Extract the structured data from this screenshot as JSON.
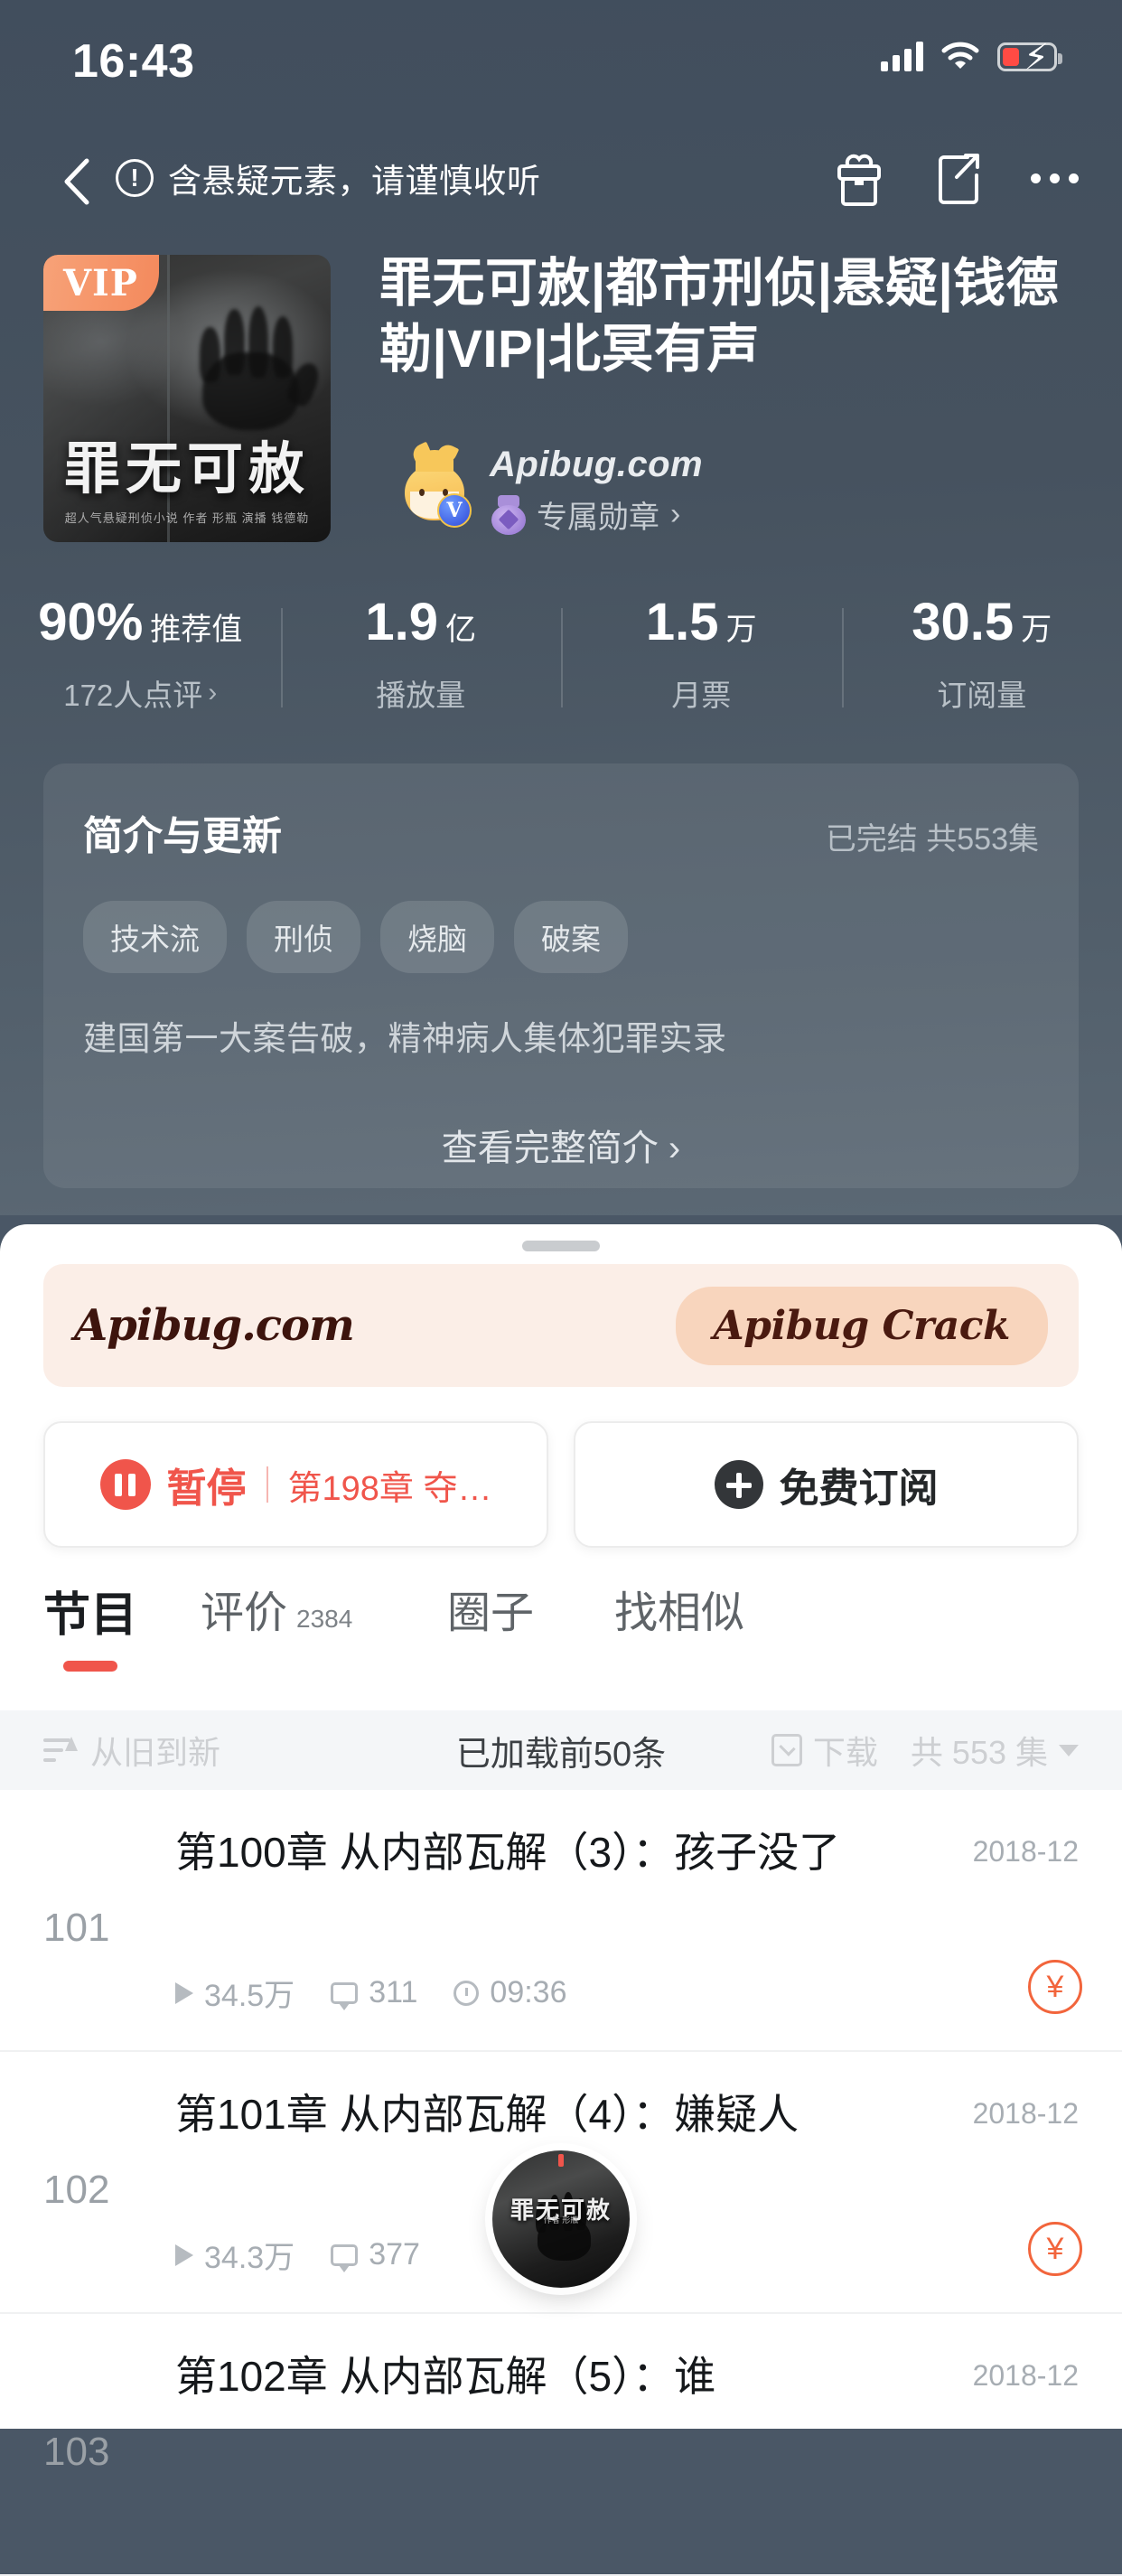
{
  "status_bar": {
    "time": "16:43",
    "icons": [
      "signal-bars-icon",
      "wifi-icon",
      "battery-charging-icon"
    ]
  },
  "nav_bar": {
    "back_icon": "chevron-left-icon",
    "warning_icon": "exclamation-circle-icon",
    "warning_text": "含悬疑元素，请谨慎收听",
    "gift_icon": "gift-icon",
    "share_icon": "share-icon",
    "more_icon": "more-dots-icon"
  },
  "album": {
    "cover_badge": "VIP",
    "cover_title": "罪无可赦",
    "cover_subtitle": "超人气悬疑刑侦小说    作者 形瓶    演播 钱德勒",
    "title": "罪无可赦|都市刑侦|悬疑|钱德勒|VIP|北冥有声",
    "author_name": "Apibug.com",
    "author_verified_glyph": "V",
    "medal_label": "专属勋章",
    "medal_chevron": "›"
  },
  "stats": [
    {
      "value": "90%",
      "unit": "推荐值",
      "label": "172人点评",
      "chevron": "›"
    },
    {
      "value": "1.9",
      "unit": "亿",
      "label": "播放量",
      "chevron": ""
    },
    {
      "value": "1.5",
      "unit": "万",
      "label": "月票",
      "chevron": ""
    },
    {
      "value": "30.5",
      "unit": "万",
      "label": "订阅量",
      "chevron": ""
    }
  ],
  "intro_card": {
    "title": "简介与更新",
    "status": "已完结 共553集",
    "tags": [
      "技术流",
      "刑侦",
      "烧脑",
      "破案"
    ],
    "description": "建国第一大案告破，精神病人集体犯罪实录",
    "full_intro_link": "查看完整简介 ›"
  },
  "banner": {
    "left_text": "Apibug.com",
    "button_label": "Apibug Crack"
  },
  "actions": {
    "pause_icon": "pause-icon",
    "pause_label": "暂停",
    "pause_episode": "第198章 夺…",
    "subscribe_icon": "plus-circle-icon",
    "subscribe_label": "免费订阅"
  },
  "tabs": [
    {
      "label": "节目",
      "count": "",
      "active": true
    },
    {
      "label": "评价",
      "count": "2384",
      "active": false
    },
    {
      "label": "圈子",
      "count": "",
      "active": false
    },
    {
      "label": "找相似",
      "count": "",
      "active": false
    }
  ],
  "sort_bar": {
    "sort_icon": "sort-ascending-icon",
    "sort_label": "从旧到新",
    "download_icon": "download-icon",
    "download_label": "下载",
    "total_label": "共 553 集",
    "chevron_icon": "chevron-down-icon",
    "toast": "已加载前50条"
  },
  "episodes": [
    {
      "index": "101",
      "title": "第100章 从内部瓦解（3）：孩子没了",
      "date": "2018-12",
      "plays": "34.5万",
      "comments": "311",
      "duration": "09:36",
      "badge": "¥"
    },
    {
      "index": "102",
      "title": "第101章 从内部瓦解（4）：嫌疑人",
      "date": "2018-12",
      "plays": "34.3万",
      "comments": "377",
      "duration": "",
      "badge": "¥"
    },
    {
      "index": "103",
      "title": "第102章 从内部瓦解（5）：谁",
      "date": "2018-12",
      "plays": "",
      "comments": "",
      "duration": "",
      "badge": ""
    }
  ],
  "mini_player": {
    "cover_title": "罪无可赦",
    "cover_subtitle": "作者 形瓶"
  },
  "colors": {
    "hero_bg": "#4a5766",
    "accent_red": "#f0554b",
    "badge_orange": "#f2653c",
    "banner_bg": "#fbeee7",
    "vip_orange": "#f4895c"
  }
}
